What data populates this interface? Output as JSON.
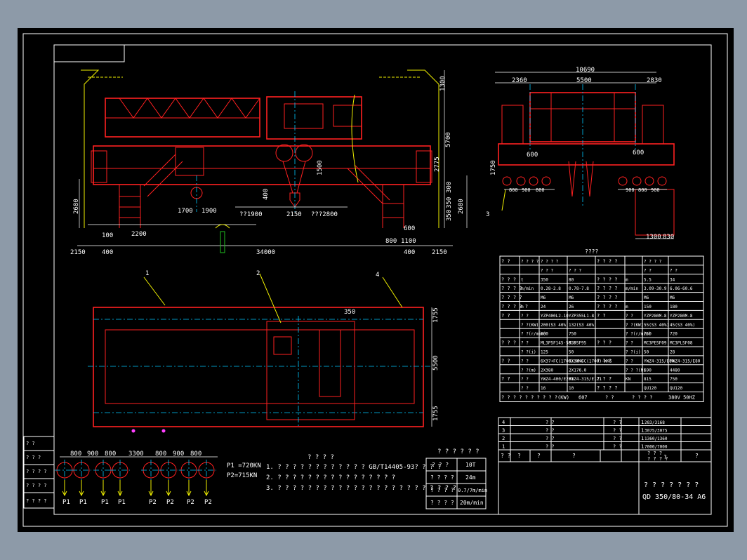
{
  "drawing": {
    "title_cn": "? ? ? ? ? ? ?",
    "drawing_no": "QD 350/80-34 A6",
    "colors": {
      "background": "#000000",
      "frame": "#ffffff",
      "structure": "#ff2020",
      "centerline": "#00c8ff",
      "rail": "#20c020",
      "leader": "#f0f000",
      "accent": "#ff40ff",
      "outer": "#8d9aa8"
    }
  },
  "front_view": {
    "dims": {
      "top_right_1": "1300",
      "right_5700": "5700",
      "right_2775": "2775",
      "right_300": "300",
      "right_2680": "2680",
      "right_350": "350",
      "right_350b": "350",
      "left_2680": "2680",
      "hook_1700": "1700",
      "hook_1900": "1900",
      "hook_400": "400",
      "hook_1500": "1500",
      "trolley_1900": "??1900",
      "trolley_2150": "2150",
      "trolley_2800": "???2800",
      "bottom_100": "100",
      "bottom_2200": "2200",
      "bottom_600": "600",
      "bottom_800": "800",
      "bottom_1100": "1100",
      "span_2150_l": "2150",
      "span_400_l": "400",
      "span_34000": "34000",
      "span_400_r": "400",
      "span_2150_r": "2150"
    }
  },
  "side_view": {
    "dims": {
      "overall": "10690",
      "left": "2360",
      "middle": "5500",
      "right": "2830",
      "left_600": "600",
      "right_600": "600",
      "height_1750": "1750",
      "w_800a": "800",
      "w_900a": "900",
      "w_800b": "800",
      "w_900b": "900",
      "w_800c": "800",
      "w_900c": "900",
      "bottom_1300": "1300",
      "bottom_830": "830",
      "leader_3": "3"
    }
  },
  "plan_view": {
    "callouts": [
      "1",
      "2",
      "4"
    ],
    "dims": {
      "d350": "350",
      "d1755a": "1755",
      "d5500": "5500",
      "d1755b": "1755"
    }
  },
  "wheel_loads": {
    "spacing": [
      "800",
      "900",
      "800",
      "3300",
      "800",
      "900",
      "800"
    ],
    "labels": [
      "P1",
      "P1",
      "P1",
      "P1",
      "P2",
      "P2",
      "P2",
      "P2"
    ],
    "p1": "P1 =720KN",
    "p2": "P2=715KN"
  },
  "notes": {
    "title": "? ? ? ?",
    "lines": [
      "1. ? ? ? ? ? ? ? ? ? ? ? ? GB/T14405-93? ? ? ?",
      "2. ? ? ? ? ? ? ? ? ? ? ? ? ? ? ? ?",
      "3. ? ? ? ? ? ? ? ? ? ? ? ? ? ? ? ? ? ? ? ? ? ? ? ?"
    ]
  },
  "small_table": {
    "title": "? ? ? ? ? ?",
    "rows": [
      [
        "? ? ?",
        "10T"
      ],
      [
        "? ? ? ?",
        "24m"
      ],
      [
        "? ? ? ?",
        "0.7/7m/min"
      ],
      [
        "? ? ? ?",
        "20m/min"
      ]
    ]
  },
  "spec_table": {
    "title": "????",
    "left_rows": [
      {
        "label": "? ?",
        "unit": "? ? ? ?",
        "v1": "? ? ? ?",
        "v2": ""
      },
      {
        "label": "",
        "unit": "",
        "v1": "? ? ?",
        "v2": "? ? ?"
      },
      {
        "label": "? ? ?",
        "unit": "t",
        "v1": "350",
        "v2": "80"
      },
      {
        "label": "? ? ? ?",
        "unit": "m/min",
        "v1": "0.28-2.8",
        "v2": "0.78-7.8"
      },
      {
        "label": "? ? ? ?",
        "unit": "",
        "v1": "M6",
        "v2": "M6"
      },
      {
        "label": "? ? ? ? ?",
        "unit": "m",
        "v1": "24",
        "v2": "26"
      },
      {
        "label": "? ?",
        "unit": "? ?",
        "v1": "YZP400L2-10",
        "v2": "YZP355L1-8"
      },
      {
        "label": "",
        "unit": "? ?(KW)",
        "v1": "200(S3 40%)",
        "v2": "132(S3 40%)"
      },
      {
        "label": "",
        "unit": "? ?(r/min)",
        "v1": "600",
        "v2": "750"
      },
      {
        "label": "? ? ?",
        "unit": "? ?",
        "v1": "ML3PSF145-56.5",
        "v2": "M3PSF95"
      },
      {
        "label": "",
        "unit": "? ?(i)",
        "v1": "125",
        "v2": "50"
      },
      {
        "label": "? ?",
        "unit": "? ?",
        "v1": "6X37+FC(1700)-WKG",
        "v2": "6X37+FC(1700)-WKG"
      },
      {
        "label": "",
        "unit": "? ?(m)",
        "v1": "2X380",
        "v2": "2X176.0"
      },
      {
        "label": "? ?",
        "unit": "? ?",
        "v1": "YWZ4-400/E201",
        "v2": "YWZ4-315/E121"
      },
      {
        "label": "",
        "unit": "? ?",
        "v1": "16",
        "v2": "10"
      }
    ],
    "right_rows": [
      {
        "label": "? ? ? ?",
        "unit": "",
        "v1": "? ? ? ?",
        "v2": ""
      },
      {
        "label": "",
        "unit": "",
        "v1": "? ?",
        "v2": "? ?"
      },
      {
        "label": "? ? ? ?",
        "unit": "m",
        "v1": "5.5",
        "v2": "34"
      },
      {
        "label": "? ? ? ?",
        "unit": "m/min",
        "v1": "3.09-30.9",
        "v2": "6.06-60.6"
      },
      {
        "label": "? ? ? ?",
        "unit": "",
        "v1": "M6",
        "v2": "M6"
      },
      {
        "label": "? ? ? ?",
        "unit": "m",
        "v1": "150",
        "v2": "180"
      },
      {
        "label": "? ?",
        "unit": "? ?",
        "v1": "YZP280M-8",
        "v2": "YZP280M-8"
      },
      {
        "label": "",
        "unit": "? ?(KW)",
        "v1": "55(S3 40%)",
        "v2": "45(S3 40%)"
      },
      {
        "label": "",
        "unit": "? ?(r/min)",
        "v1": "750",
        "v2": "720"
      },
      {
        "label": "? ? ?",
        "unit": "? ?",
        "v1": "MC3PESF09",
        "v2": "MC3PLSF08"
      },
      {
        "label": "",
        "unit": "? ?(i)",
        "v1": "50",
        "v2": "28"
      },
      {
        "label": "? ? ?",
        "unit": "? ?",
        "v1": "YWZ4-315/E80",
        "v2": "YWZ4-315/E80"
      },
      {
        "label": "",
        "unit": "? ? ?(N)",
        "v1": "690",
        "v2": "4480"
      },
      {
        "label": "? ? ?",
        "unit": "KN",
        "v1": "815",
        "v2": "750"
      },
      {
        "label": "? ? ? ?",
        "unit": "",
        "v1": "QU120",
        "v2": "QU120"
      }
    ],
    "footer": [
      "? ? ? ? ? ? ? ? ? ?(KW)",
      "607",
      "? ?",
      "? ? ? ?",
      "380V 50HZ"
    ]
  },
  "parts_list": {
    "rows": [
      {
        "no": "4",
        "name": "? ?",
        "qty": "? ?",
        "mat": "1",
        "note": "283/3168"
      },
      {
        "no": "3",
        "name": "? ?",
        "qty": "? ?",
        "mat": "1",
        "note": "3075/3075"
      },
      {
        "no": "2",
        "name": "? ?",
        "qty": "? ?",
        "mat": "1",
        "note": "1360/1360"
      },
      {
        "no": "1",
        "name": "? ?",
        "qty": "? ?",
        "mat": "1",
        "note": "7000/7000"
      }
    ],
    "header": [
      "? ?",
      "?",
      "?",
      "?",
      "? ? ?",
      "?",
      "?"
    ],
    "small_header": "? ? ? ?"
  },
  "revision_block": {
    "rows": [
      "? ?",
      "? ? ?",
      "? ? ? ?",
      "? ? ? ?",
      "? ? ? ?"
    ]
  }
}
